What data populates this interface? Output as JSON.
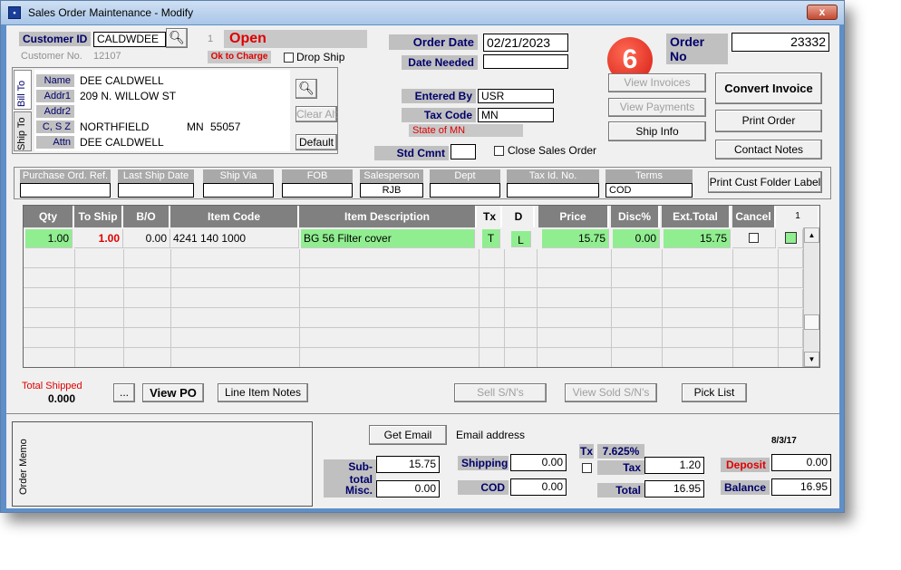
{
  "window": {
    "title": "Sales Order Maintenance - Modify",
    "close": "x"
  },
  "badge": "6",
  "customer": {
    "id_label": "Customer ID",
    "id_value": "CALDWDEE",
    "no_label": "Customer No.",
    "no_value": "12107",
    "count": "1",
    "status": "Open",
    "ok_to_charge": "Ok to Charge",
    "drop_ship": "Drop Ship"
  },
  "address": {
    "tabs": [
      "Bill To",
      "Ship To"
    ],
    "labels": {
      "name": "Name",
      "addr1": "Addr1",
      "addr2": "Addr2",
      "csz": "C, S Z",
      "attn": "Attn"
    },
    "name": "DEE CALDWELL",
    "addr1": "209 N. WILLOW ST",
    "addr2": "",
    "city": "NORTHFIELD",
    "state": "MN",
    "zip": "55057",
    "attn": "DEE CALDWELL",
    "clear_alt": "Clear Alt",
    "default": "Default"
  },
  "order": {
    "date_label": "Order Date",
    "date_value": "02/21/2023",
    "needed_label": "Date Needed",
    "needed_value": "",
    "no_label": "Order No",
    "no_value": "23332",
    "entered_by_label": "Entered By",
    "entered_by_value": "USR",
    "tax_code_label": "Tax Code",
    "tax_code_value": "MN",
    "state_text": "State of MN",
    "std_cmnt_label": "Std Cmnt",
    "std_cmnt_value": "",
    "close_order": "Close Sales Order"
  },
  "buttons": {
    "view_invoices": "View Invoices",
    "view_payments": "View Payments",
    "ship_info": "Ship Info",
    "convert_invoice": "Convert Invoice",
    "print_order": "Print Order",
    "contact_notes": "Contact Notes",
    "print_folder": "Print Cust Folder Label",
    "ellipsis": "...",
    "view_po": "View PO",
    "line_notes": "Line Item Notes",
    "sell_sn": "Sell S/N's",
    "view_sold_sn": "View Sold S/N's",
    "pick_list": "Pick List",
    "get_email": "Get Email"
  },
  "header_fields": [
    {
      "label": "Purchase Ord. Ref.",
      "value": ""
    },
    {
      "label": "Last Ship Date",
      "value": ""
    },
    {
      "label": "Ship Via",
      "value": ""
    },
    {
      "label": "FOB",
      "value": ""
    },
    {
      "label": "Salesperson",
      "value": "RJB"
    },
    {
      "label": "Dept",
      "value": ""
    },
    {
      "label": "Tax Id. No.",
      "value": ""
    },
    {
      "label": "Terms",
      "value": "COD"
    }
  ],
  "grid": {
    "columns": [
      "Qty",
      "To Ship",
      "B/O",
      "Item Code",
      "Item Description",
      "Tx",
      "D",
      "Price",
      "Disc%",
      "Ext.Total",
      "Cancel",
      "1"
    ],
    "rows": [
      {
        "qty": "1.00",
        "to_ship": "1.00",
        "bo": "0.00",
        "item_code": "4241 140 1000",
        "description": "BG 56 Filter cover",
        "tx": "T",
        "d": "L",
        "price": "15.75",
        "disc": "0.00",
        "ext_total": "15.75"
      }
    ]
  },
  "totals": {
    "total_shipped_label": "Total Shipped",
    "total_shipped_value": "0.000",
    "email_label": "Email address",
    "memo_label": "Order Memo",
    "subtotal_label": "Sub-total",
    "subtotal_value": "15.75",
    "misc_label": "Misc.",
    "misc_value": "0.00",
    "shipping_label": "Shipping",
    "shipping_value": "0.00",
    "cod_label": "COD",
    "cod_value": "0.00",
    "tx_label": "Tx",
    "tax_rate": "7.625%",
    "tax_label": "Tax",
    "tax_value": "1.20",
    "total_label": "Total",
    "total_value": "16.95",
    "date_small": "8/3/17",
    "deposit_label": "Deposit",
    "deposit_value": "0.00",
    "balance_label": "Balance",
    "balance_value": "16.95"
  },
  "colors": {
    "grid_highlight": "#90ee90",
    "label_text": "#00006b",
    "status_red": "#e00000",
    "badge": "#e0261c"
  }
}
